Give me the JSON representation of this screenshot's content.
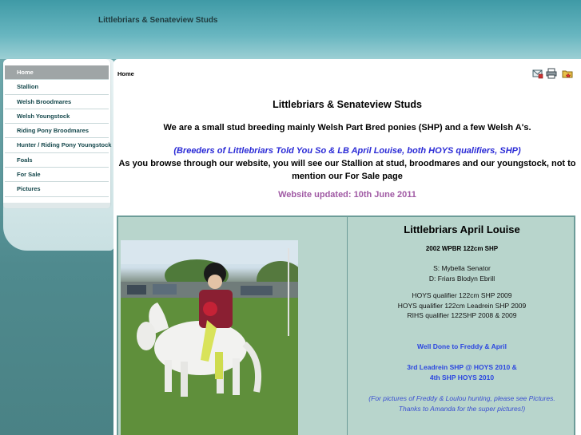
{
  "header": {
    "site_title": "Littlebriars & Senateview Studs"
  },
  "sidebar": {
    "items": [
      {
        "label": "Home",
        "active": true
      },
      {
        "label": "Stallion"
      },
      {
        "label": "Welsh Broodmares"
      },
      {
        "label": "Welsh Youngstock"
      },
      {
        "label": "Riding Pony Broodmares"
      },
      {
        "label": "Hunter / Riding Pony Youngstock"
      },
      {
        "label": "Foals"
      },
      {
        "label": "For Sale"
      },
      {
        "label": "Pictures"
      }
    ]
  },
  "main": {
    "breadcrumb": "Home",
    "tools": [
      {
        "icon": "email-page-icon"
      },
      {
        "icon": "print-icon"
      },
      {
        "icon": "bookmark-folder-icon"
      }
    ],
    "intro": {
      "title": "Littlebriars & Senateview Studs",
      "line1": "We are a small stud breeding mainly Welsh Part Bred ponies (SHP) and a few Welsh A's.",
      "breeders": "(Breeders of Littlebriars Told You So & LB April Louise, both HOYS qualifiers, SHP)",
      "browse": "As you browse through our website, you will see our Stallion at stud, broodmares and our youngstock, not to mention our For Sale page",
      "updated": "Website updated: 10th June 2011"
    },
    "feature": {
      "name": "Littlebriars April Louise",
      "subtitle": "2002 WPBR 122cm SHP",
      "sire": "S: Mybella Senator",
      "dam": "D: Friars Blodyn Ebrill",
      "achievements": [
        "HOYS qualifier 122cm SHP 2009",
        "HOYS qualifier 122cm Leadrein SHP 2009",
        "RIHS qualifier 122SHP 2008 & 2009"
      ],
      "well_done": "Well Done to Freddy & April",
      "result1": "3rd Leadrein SHP @ HOYS 2010 &",
      "result2": "4th SHP HOYS 2010",
      "pictures_note1": "(For pictures of Freddy & Loulou hunting, please see Pictures.",
      "pictures_note2": "Thanks to Amanda for the super pictures!)"
    }
  },
  "colors": {
    "header_top": "#3f9aa6",
    "link_blue": "#2a2ad6",
    "update_purple": "#a05aa4",
    "feature_bg": "#b8d5cc"
  }
}
